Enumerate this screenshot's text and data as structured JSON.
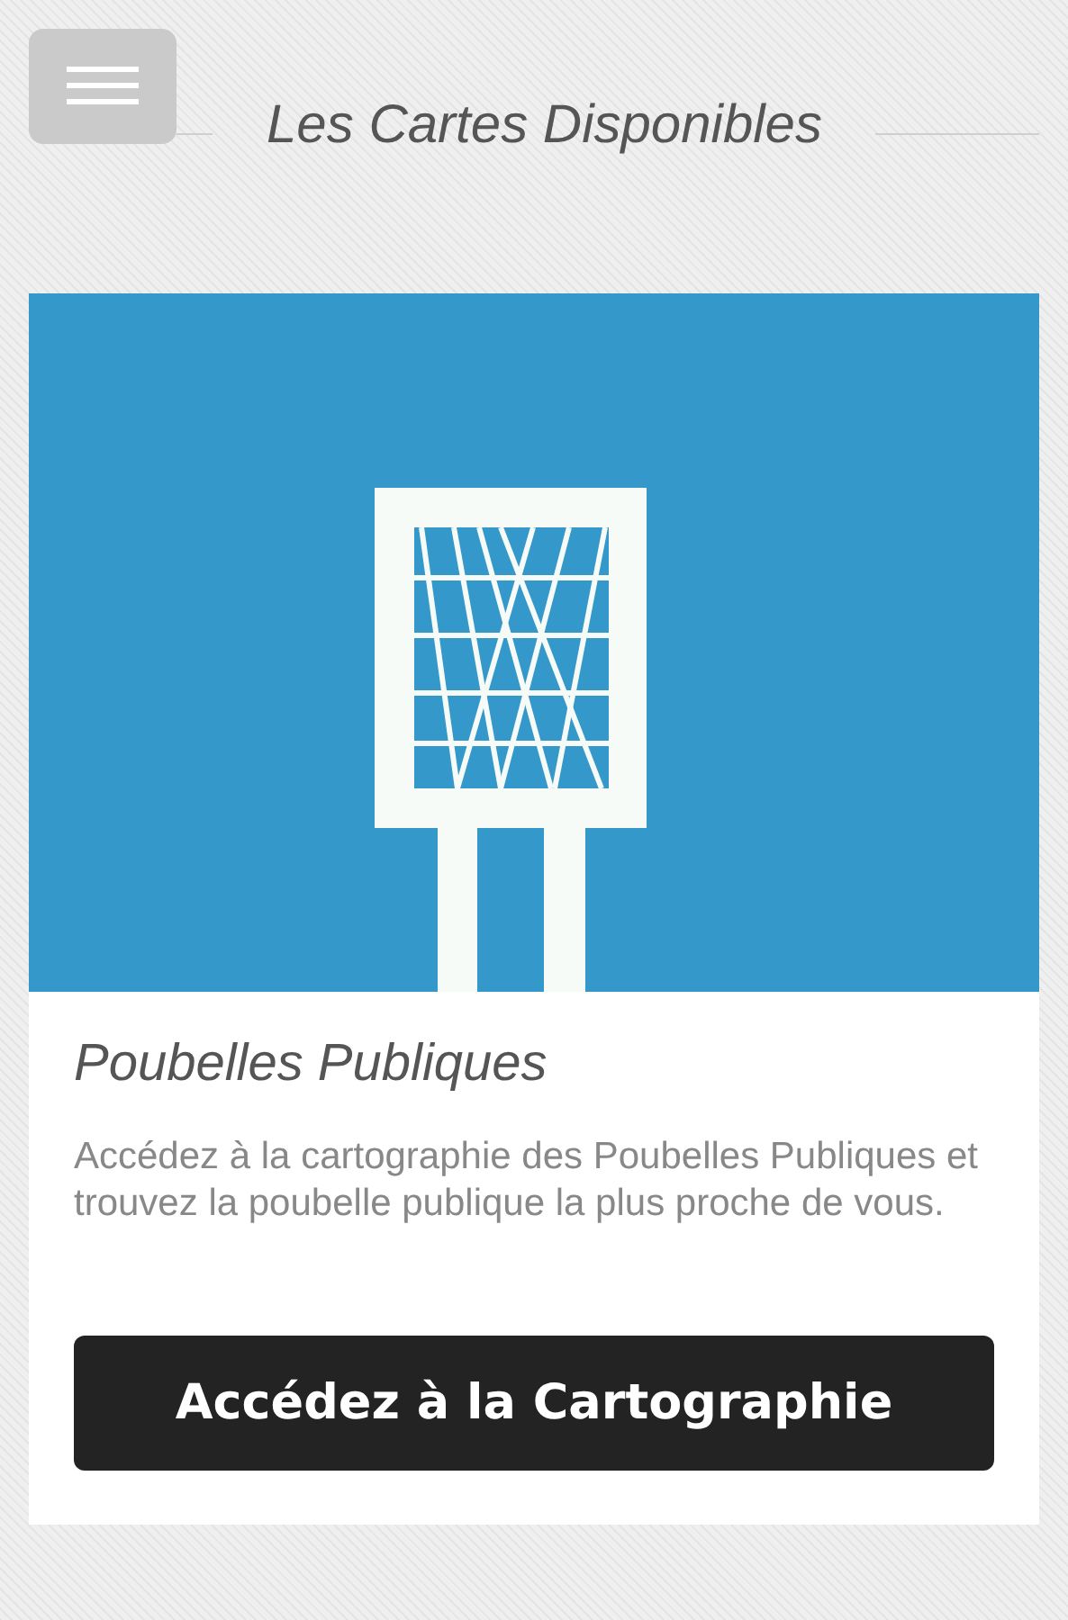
{
  "header": {
    "title": "Les Cartes Disponibles"
  },
  "card": {
    "title": "Poubelles Publiques",
    "description": "Accédez à la cartographie des Poubelles Publiques et trouvez la poubelle publique la plus proche de vous.",
    "button": "Accédez à la Cartographie"
  }
}
